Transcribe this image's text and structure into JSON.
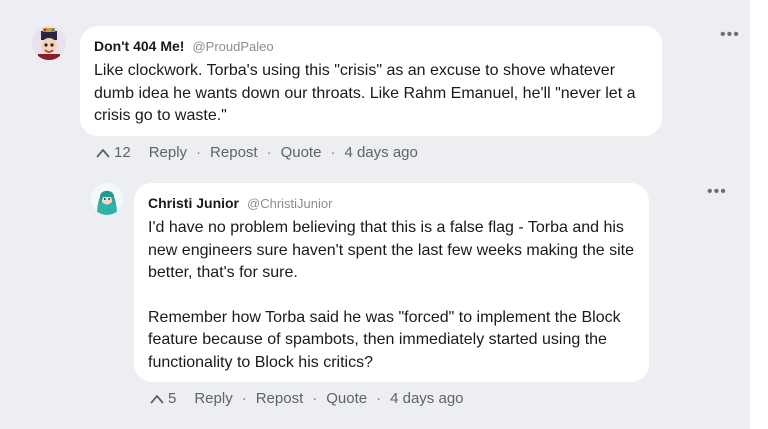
{
  "comments": [
    {
      "author": "Don't 404 Me!",
      "handle": "@ProudPaleo",
      "text": "Like clockwork. Torba's using this \"crisis\" as an excuse to shove whatever dumb idea he wants down our throats. Like Rahm Emanuel, he'll \"never let a crisis go to waste.\"",
      "like_count": "12",
      "reply_label": "Reply",
      "repost_label": "Repost",
      "quote_label": "Quote",
      "time": "4 days ago",
      "more_label": "•••"
    },
    {
      "author": "Christi Junior",
      "handle": "@ChristiJunior",
      "text_p1": "I'd have no problem believing that this is a false flag - Torba and his new engineers sure haven't spent the last few weeks making the site better, that's for sure.",
      "text_p2": "Remember how Torba said he was \"forced\" to implement the Block feature because of spambots, then immediately started using the functionality to Block his critics?",
      "like_count": "5",
      "reply_label": "Reply",
      "repost_label": "Repost",
      "quote_label": "Quote",
      "time": "4 days ago",
      "more_label": "•••"
    }
  ],
  "separator": "·",
  "colors": {
    "background": "#eceef2",
    "bubble": "#ffffff",
    "muted": "#5f6368"
  }
}
